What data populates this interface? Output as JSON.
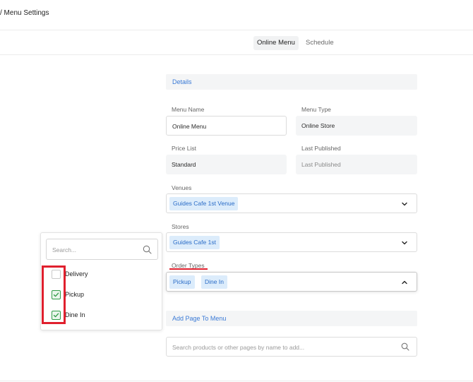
{
  "header": {
    "title": "/ Menu Settings"
  },
  "tabs": [
    {
      "label": "Online Menu",
      "active": true
    },
    {
      "label": "Schedule",
      "active": false
    }
  ],
  "details": {
    "section_title": "Details",
    "menu_name": {
      "label": "Menu Name",
      "value": "Online Menu"
    },
    "menu_type": {
      "label": "Menu Type",
      "value": "Online Store"
    },
    "price_list": {
      "label": "Price List",
      "value": "Standard"
    },
    "last_published": {
      "label": "Last Published",
      "value": "Last Published"
    }
  },
  "venues": {
    "label": "Venues",
    "chips": [
      "Guides Cafe 1st Venue"
    ]
  },
  "stores": {
    "label": "Stores",
    "chips": [
      "Guides Cafe 1st"
    ]
  },
  "order_types": {
    "label": "Order Types",
    "chips": [
      "Pickup",
      "Dine In"
    ]
  },
  "add_page": {
    "section_title": "Add Page To Menu",
    "search_placeholder": "Search products or other pages by name to add..."
  },
  "dropdown": {
    "search_placeholder": "Search...",
    "options": [
      {
        "label": "Delivery",
        "checked": false
      },
      {
        "label": "Pickup",
        "checked": true
      },
      {
        "label": "Dine In",
        "checked": true
      }
    ]
  },
  "colors": {
    "accent": "#3a7ad6",
    "chip_bg": "#dcecfb",
    "check_green": "#2f9a45",
    "annotation_red": "#e0202e"
  },
  "icons": {
    "chevron_down": "chevron-down-icon",
    "chevron_up": "chevron-up-icon",
    "search": "search-icon",
    "check": "checkmark-icon"
  }
}
